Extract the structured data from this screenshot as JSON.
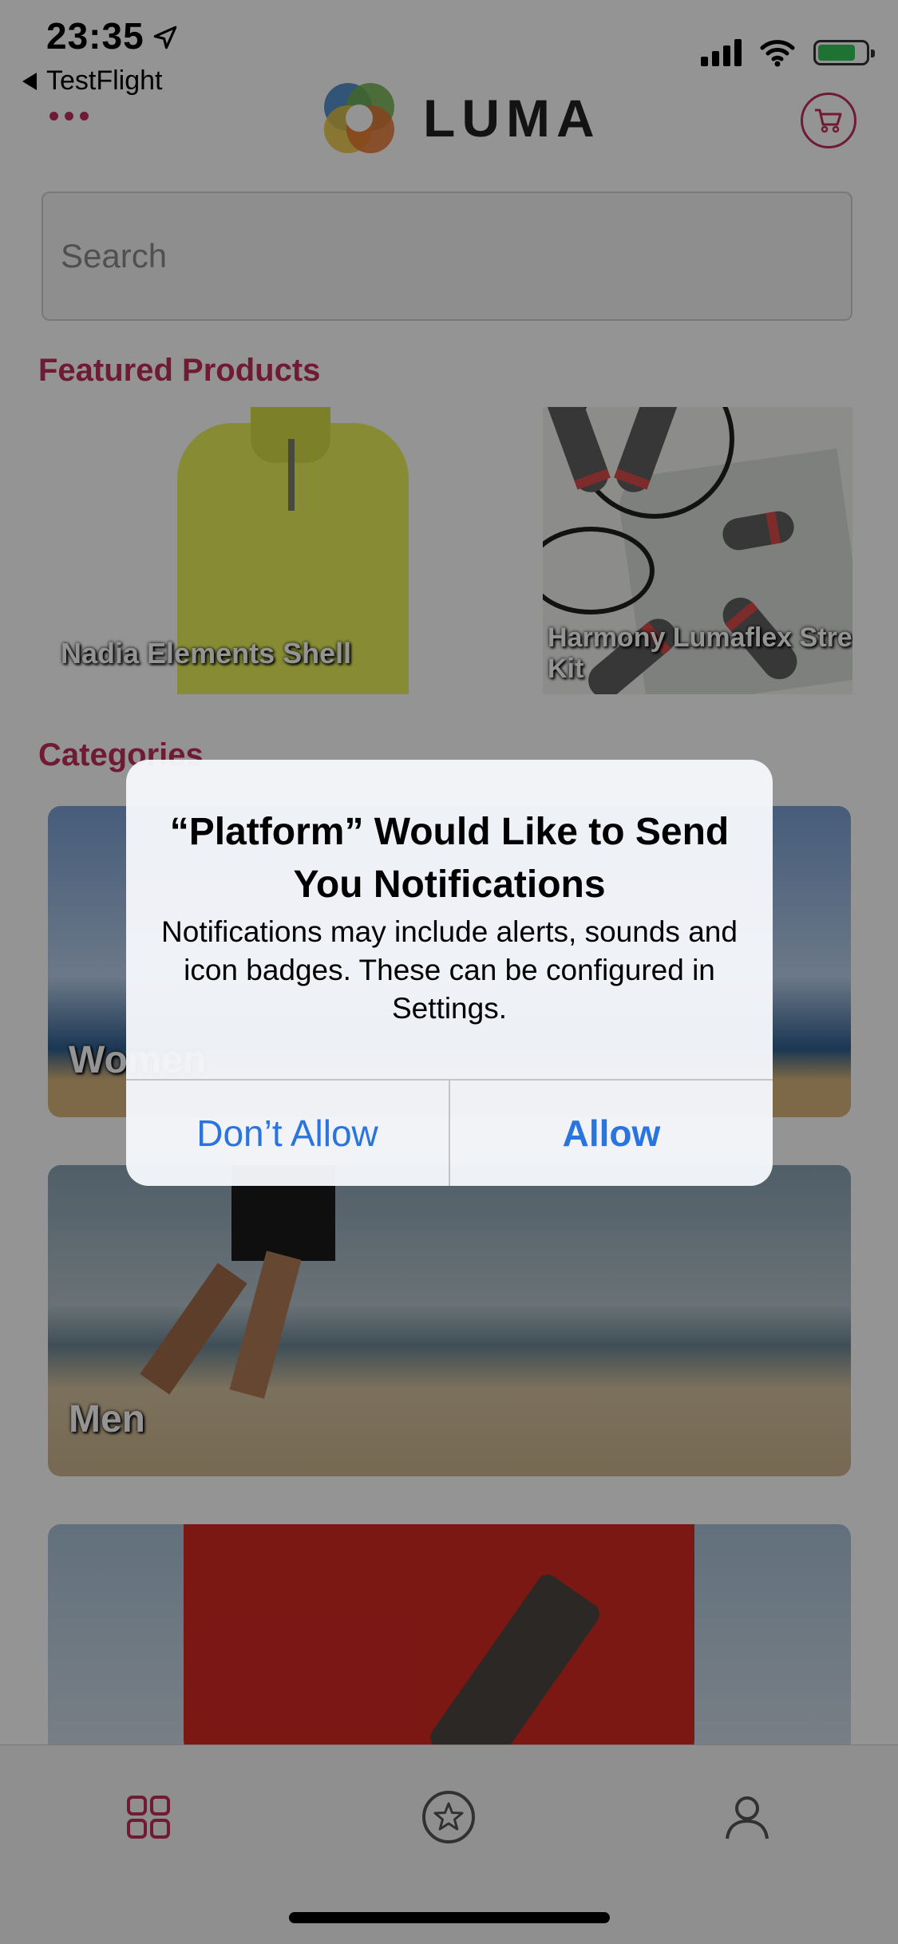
{
  "status_bar": {
    "time": "23:35",
    "back_app": "TestFlight"
  },
  "header": {
    "brand": "LUMA",
    "menu_icon": "more-dots-icon",
    "cart_icon": "cart-icon"
  },
  "search": {
    "placeholder": "Search",
    "value": ""
  },
  "featured": {
    "title": "Featured Products",
    "products": [
      {
        "name": "Nadia Elements Shell"
      },
      {
        "name": "Harmony Lumaflex Strength Band Kit"
      }
    ]
  },
  "categories": {
    "title": "Categories",
    "items": [
      {
        "label": "Women"
      },
      {
        "label": "Men"
      },
      {
        "label": ""
      }
    ]
  },
  "tabbar": {
    "items": [
      {
        "icon": "grid-icon"
      },
      {
        "icon": "star-icon"
      },
      {
        "icon": "user-icon"
      }
    ]
  },
  "alert": {
    "title": "“Platform” Would Like to Send You Notifications",
    "message": "Notifications may include alerts, sounds and icon badges. These can be configured in Settings.",
    "deny_label": "Don’t Allow",
    "allow_label": "Allow"
  },
  "colors": {
    "accent": "#c0305a",
    "alert_button": "#2a74e0",
    "battery": "#34c759"
  }
}
